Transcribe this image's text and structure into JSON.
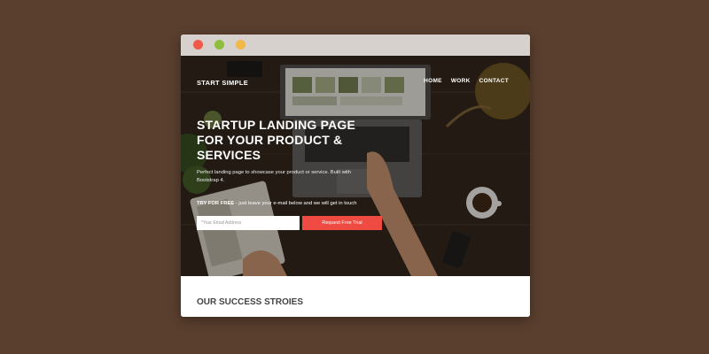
{
  "header": {
    "brand": "START SIMPLE",
    "nav": [
      "HOME",
      "WORK",
      "CONTACT"
    ]
  },
  "hero": {
    "headline": "STARTUP LANDING PAGE FOR YOUR PRODUCT & SERVICES",
    "subtext": "Perfect landing page to showcase your product or service. Built with Bootstrap 4.",
    "try_label": "TRY FOR FREE",
    "try_text": " - just leave your e-mail below and we will get in touch",
    "email_placeholder": "*Your Email Address",
    "cta_label": "Request Free Trial"
  },
  "section": {
    "title": "OUR SUCCESS STROIES"
  },
  "colors": {
    "background": "#5a3f2e",
    "cta": "#f04b43",
    "dot_red": "#f15a4a",
    "dot_green": "#8fbe3f",
    "dot_yellow": "#f2b84b"
  }
}
